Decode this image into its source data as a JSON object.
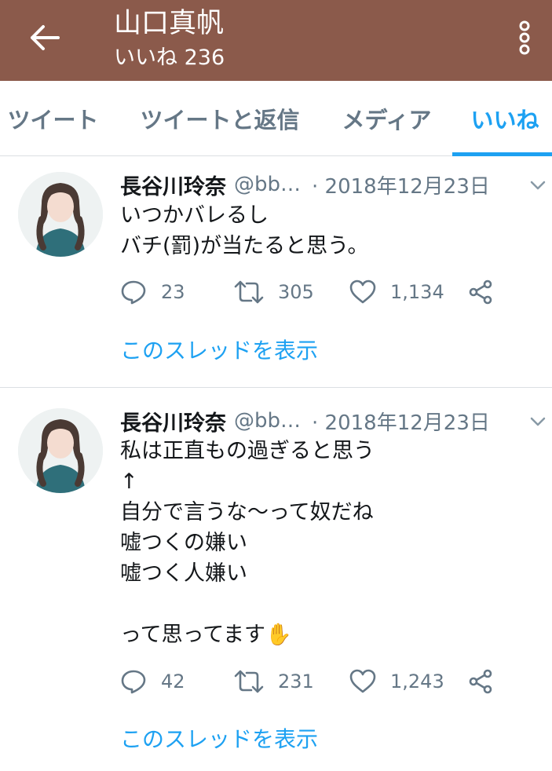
{
  "header": {
    "title": "山口真帆",
    "subtitle": "いいね 236",
    "color": "#8b5a4b"
  },
  "tabs": [
    {
      "label": "ツイート",
      "active": false
    },
    {
      "label": "ツイートと返信",
      "active": false
    },
    {
      "label": "メディア",
      "active": false
    },
    {
      "label": "いいね",
      "active": true
    }
  ],
  "accent_color": "#1da1f2",
  "tweets": [
    {
      "name": "長谷川玲奈",
      "handle": "@bb…",
      "date": "· 2018年12月23日",
      "text": "いつかバレるし\nバチ(罰)が当たると思う。",
      "replies": "23",
      "retweets": "305",
      "likes": "1,134",
      "thread_link": "このスレッドを表示"
    },
    {
      "name": "長谷川玲奈",
      "handle": "@bb…",
      "date": "· 2018年12月23日",
      "text": "私は正直もの過ぎると思う\n↑\n自分で言うな〜って奴だね\n嘘つくの嫌い\n嘘つく人嫌い\n\nって思ってます",
      "emoji": "✋",
      "replies": "42",
      "retweets": "231",
      "likes": "1,243",
      "thread_link": "このスレッドを表示"
    }
  ],
  "icons": [
    "back-arrow-icon",
    "more-vertical-icon",
    "chevron-down-icon",
    "reply-icon",
    "retweet-icon",
    "like-icon",
    "share-icon"
  ]
}
